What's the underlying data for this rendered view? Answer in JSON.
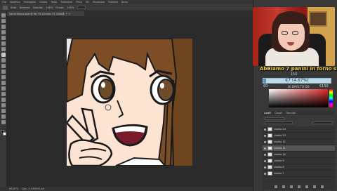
{
  "app": {
    "menu": [
      "File",
      "Modifica",
      "Immagine",
      "Livello",
      "Testo",
      "Selezione",
      "Filtro",
      "3D",
      "Visualizza",
      "Finestra",
      "Aiuto"
    ],
    "options_bar": [
      "Stilo:",
      "Normale",
      "Opacità:",
      "100%",
      "Flusso:",
      "100%"
    ],
    "document_tab": "SanScrittura.psd @ 66,7% (Livello 13, RGB/8) *",
    "tab_close": "×",
    "status": [
      "66,67%",
      "Doc: 5,93M/99,4M"
    ]
  },
  "stream_overlay": {
    "goal_text": "AbBiamo 7 panini in forno su 50!",
    "goal_target": "150",
    "goal_amount": "€7 (4.67%)",
    "goal_progress": 0.0467,
    "goal_min": "€0",
    "goal_days": "10 DAYS TO GO",
    "goal_max": "€150"
  },
  "panels": {
    "tabs": [
      "Livelli",
      "Canali",
      "Tracciati"
    ],
    "layers": [
      {
        "name": "Livello 14",
        "selected": false
      },
      {
        "name": "Livello 13",
        "selected": false
      },
      {
        "name": "Livello 12",
        "selected": false
      },
      {
        "name": "Livello 11",
        "selected": true
      },
      {
        "name": "Livello 10",
        "selected": false
      },
      {
        "name": "Livello 9",
        "selected": false
      },
      {
        "name": "Livello 8",
        "selected": false
      },
      {
        "name": "Livello 7",
        "selected": false
      }
    ]
  },
  "colors": {
    "hair": "#7d4e26",
    "skin": "#fde3d2",
    "background_brown": "#6e451f",
    "mouth": "#7a1b2c",
    "iris": "#6e4b2a",
    "goal_text": "#f2d34a"
  }
}
